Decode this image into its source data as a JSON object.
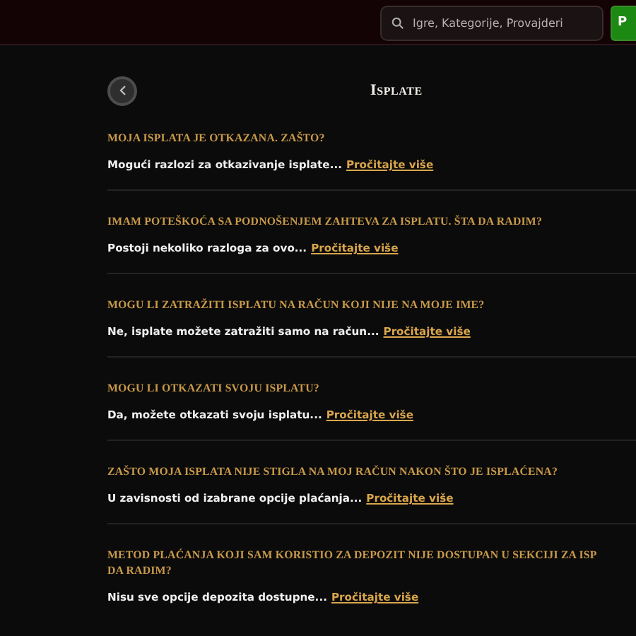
{
  "header": {
    "search": {
      "placeholder": "Igre, Kategorije, Provajderi"
    },
    "button": {
      "label": "P"
    }
  },
  "page": {
    "title": "Isplate"
  },
  "faq": [
    {
      "title": "MOJA ISPLATA JE OTKAZANA. ZAŠTO?",
      "summary": "Mogući razlozi za otkazivanje isplate...",
      "link": "Pročitajte više"
    },
    {
      "title": "IMAM POTEŠKOĆA SA PODNOŠENJEM ZAHTEVA ZA ISPLATU. ŠTA DA RADIM?",
      "summary": "Postoji nekoliko razloga za ovo...",
      "link": "Pročitajte više"
    },
    {
      "title": "MOGU LI ZATRAŽITI ISPLATU NA RAČUN KOJI NIJE NA MOJE IME?",
      "summary": "Ne, isplate možete zatražiti samo na račun...",
      "link": "Pročitajte više"
    },
    {
      "title": "MOGU LI OTKAZATI SVOJU ISPLATU?",
      "summary": "Da, možete otkazati svoju isplatu...",
      "link": "Pročitajte više"
    },
    {
      "title": "ZAŠTO MOJA ISPLATA NIJE STIGLA NA MOJ RAČUN NAKON ŠTO JE ISPLAĆENA?",
      "summary": "U zavisnosti od izabrane opcije plaćanja...",
      "link": "Pročitajte više"
    },
    {
      "title": "METOD PLAĆANJA KOJI SAM KORISTIO ZA DEPOZIT NIJE DOSTUPAN U SEKCIJI ZA ISP",
      "title_continued": "DA RADIM?",
      "summary": "Nisu sve opcije depozita dostupne...",
      "link": "Pročitajte više"
    }
  ]
}
